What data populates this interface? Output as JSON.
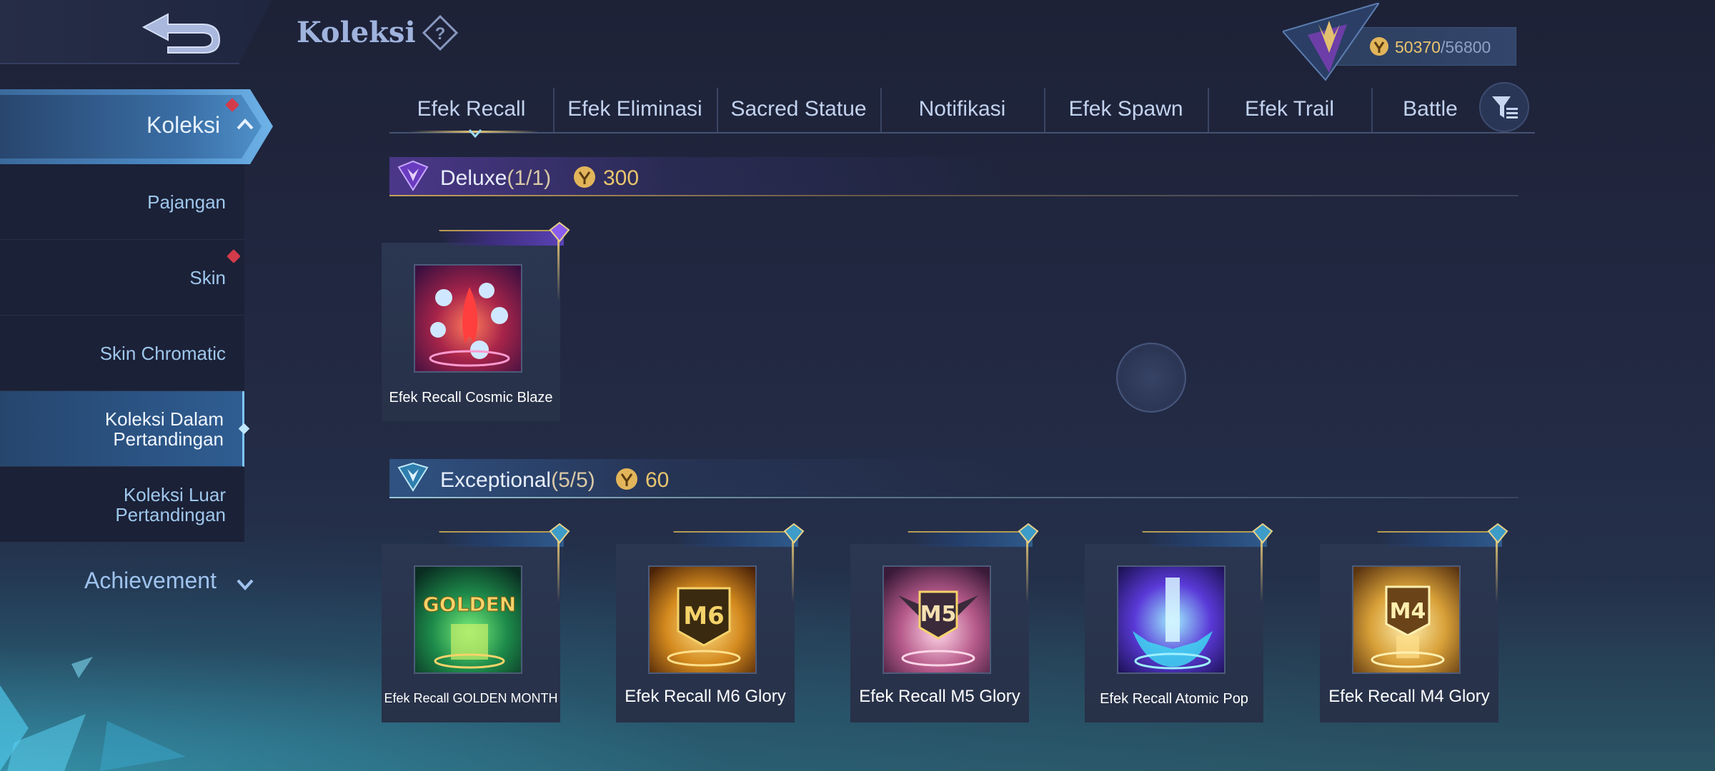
{
  "header": {
    "title": "Koleksi",
    "help_icon": "question-mark-icon",
    "currency": {
      "current": "50370",
      "max": "/56800",
      "icon": "collector-coin-icon"
    }
  },
  "sidebar": {
    "top": {
      "label": "Koleksi",
      "has_badge": true
    },
    "items": [
      {
        "label": "Pajangan",
        "active": false,
        "badge": false
      },
      {
        "label": "Skin",
        "active": false,
        "badge": true
      },
      {
        "label": "Skin Chromatic",
        "active": false,
        "badge": false
      },
      {
        "label": "Koleksi Dalam\nPertandingan",
        "active": true,
        "badge": false
      },
      {
        "label": "Koleksi Luar\nPertandingan",
        "active": false,
        "badge": false
      }
    ],
    "achievement": "Achievement"
  },
  "tabs": [
    "Efek Recall",
    "Efek Eliminasi",
    "Sacred Statue",
    "Notifikasi",
    "Efek Spawn",
    "Efek Trail",
    "Battle"
  ],
  "active_tab": "Efek Recall",
  "sections": {
    "deluxe": {
      "title": "Deluxe",
      "count": "(1/1)",
      "cost": "300",
      "items": [
        {
          "name": "Efek Recall Cosmic Blaze"
        }
      ]
    },
    "exceptional": {
      "title": "Exceptional",
      "count": "(5/5)",
      "cost": "60",
      "items": [
        {
          "name": "Efek Recall GOLDEN MONTH"
        },
        {
          "name": "Efek Recall M6 Glory"
        },
        {
          "name": "Efek Recall M5 Glory"
        },
        {
          "name": "Efek Recall Atomic Pop"
        },
        {
          "name": "Efek Recall M4 Glory"
        }
      ]
    }
  },
  "artwork_text": {
    "golden": "GOLDEN",
    "m6": "M6",
    "m5": "M5",
    "m4": "M4"
  },
  "colors": {
    "accent_gold": "#e9c56e",
    "badge_red": "#d33a4a",
    "active_blue": "#2f5d92"
  }
}
